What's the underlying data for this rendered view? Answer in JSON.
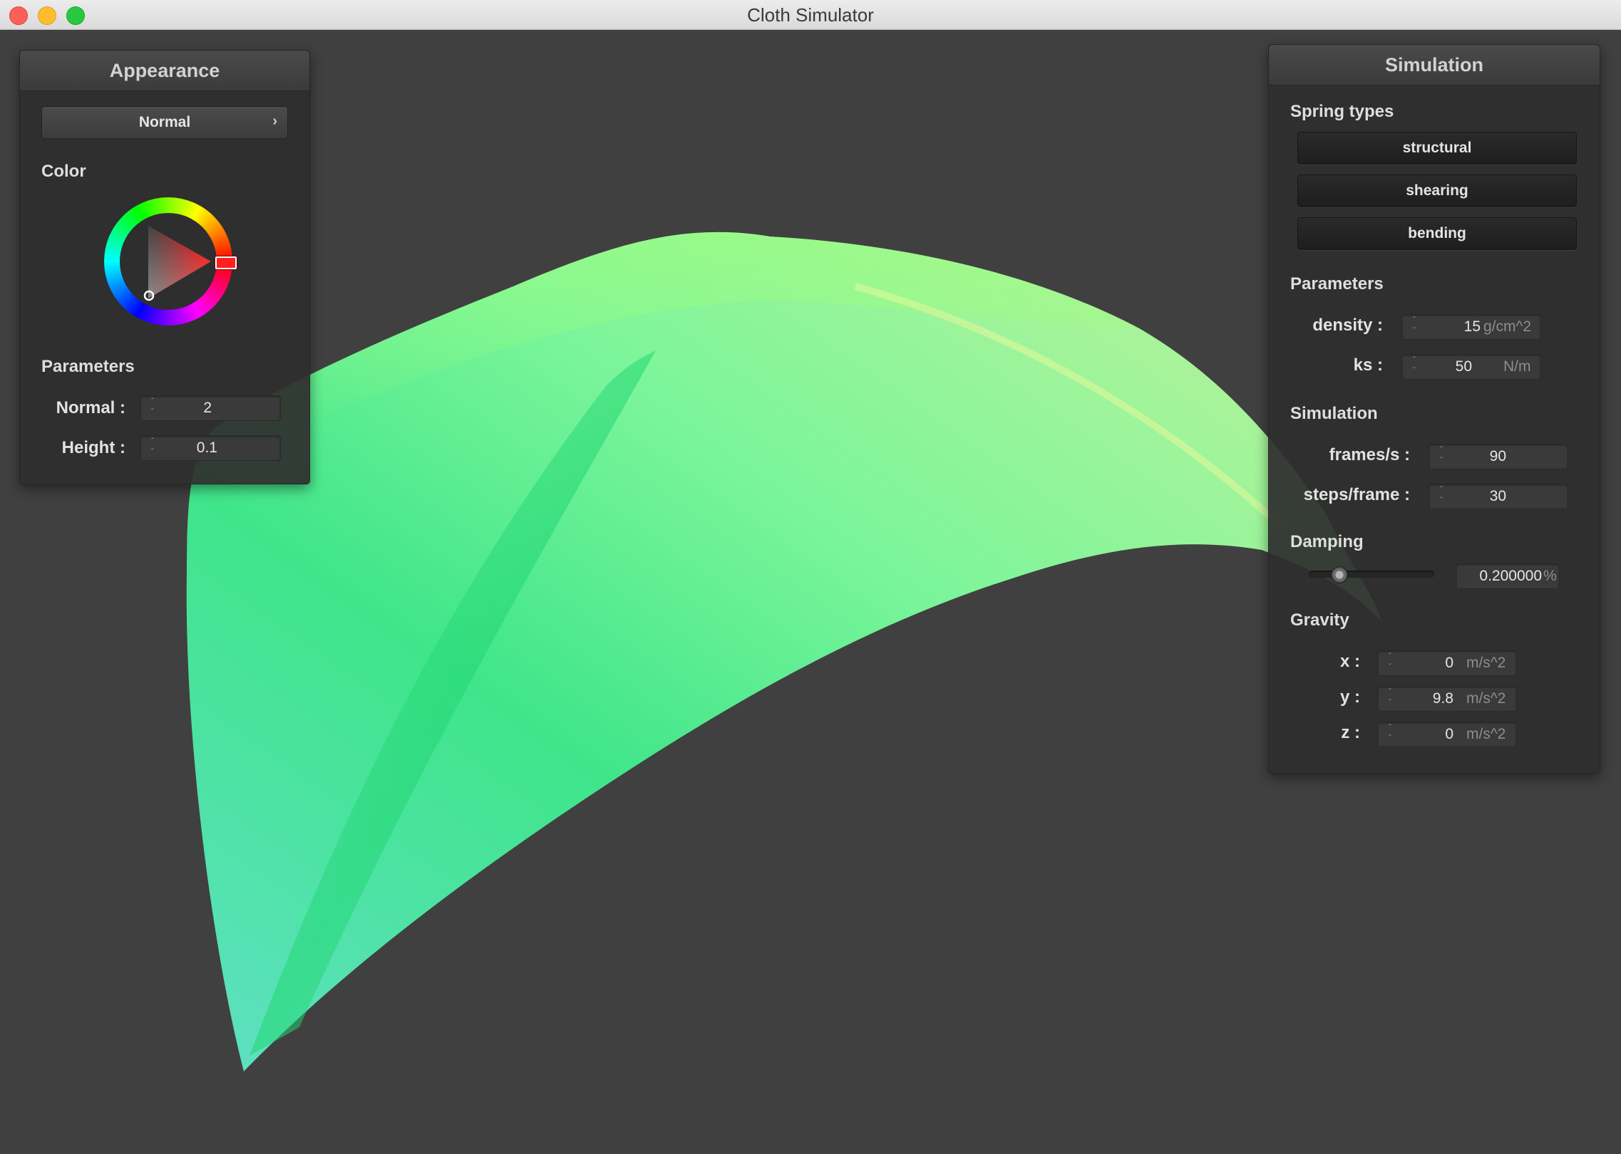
{
  "window": {
    "title": "Cloth Simulator"
  },
  "colors": {
    "cloth_light": "#9dff7a",
    "cloth_mid": "#3fe58a",
    "cloth_teal": "#5fe0c4",
    "background": "#404040"
  },
  "appearance": {
    "title": "Appearance",
    "shader_select": {
      "value": "Normal",
      "icon": "chevron-right-icon"
    },
    "color_label": "Color",
    "color_picker": {
      "selected_color": "#ff0000",
      "icon": "color-wheel"
    },
    "parameters_label": "Parameters",
    "normal": {
      "label": "Normal :",
      "value": "2"
    },
    "height": {
      "label": "Height :",
      "value": "0.1"
    }
  },
  "simulation": {
    "title": "Simulation",
    "spring_types_label": "Spring types",
    "spring_types": [
      "structural",
      "shearing",
      "bending"
    ],
    "parameters_label": "Parameters",
    "density": {
      "label": "density :",
      "value": "15",
      "unit": "g/cm^2"
    },
    "ks": {
      "label": "ks :",
      "value": "50",
      "unit": "N/m"
    },
    "simulation_label": "Simulation",
    "frames_per_s": {
      "label": "frames/s :",
      "value": "90"
    },
    "steps_per_frame": {
      "label": "steps/frame :",
      "value": "30"
    },
    "damping_label": "Damping",
    "damping": {
      "value": "0.200000",
      "unit": "%",
      "slider_fraction": 0.2
    },
    "gravity_label": "Gravity",
    "gravity": {
      "x": {
        "label": "x :",
        "value": "0",
        "unit": "m/s^2"
      },
      "y": {
        "label": "y :",
        "value": "9.8",
        "unit": "m/s^2"
      },
      "z": {
        "label": "z :",
        "value": "0",
        "unit": "m/s^2"
      }
    }
  }
}
